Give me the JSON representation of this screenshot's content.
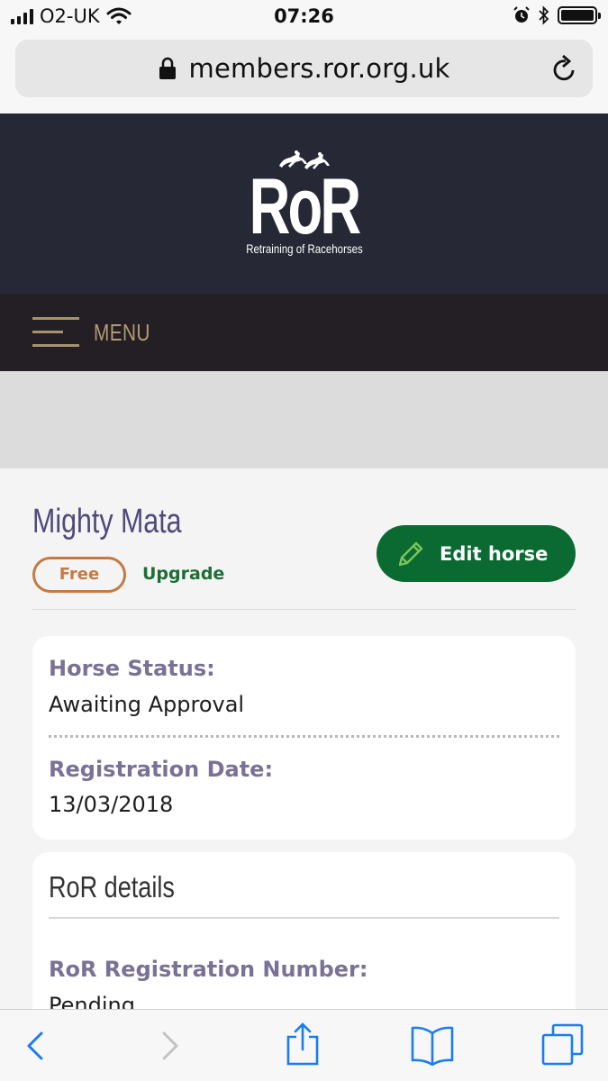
{
  "status_bar": {
    "carrier": "O2-UK",
    "time": "07:26",
    "battery_level": 1.0
  },
  "browser": {
    "url": "members.ror.org.uk"
  },
  "site": {
    "logo_text": "RoR",
    "logo_subtitle": "Retraining of Racehorses",
    "menu_label": "MENU"
  },
  "horse": {
    "name": "Mighty Mata",
    "membership_badge": "Free",
    "upgrade_link": "Upgrade",
    "edit_button": "Edit horse"
  },
  "status_card": {
    "status_label": "Horse Status:",
    "status_value": "Awaiting Approval",
    "reg_date_label": "Registration Date:",
    "reg_date_value": "13/03/2018"
  },
  "details_card": {
    "title": "RoR details",
    "reg_number_label": "RoR Registration Number:",
    "reg_number_value": "Pending"
  },
  "colors": {
    "header_bg": "#272836",
    "menu_bg": "#231f24",
    "menu_accent": "#b39b73",
    "horse_name": "#4f4a7a",
    "free_badge": "#c47a45",
    "primary_green": "#0b6a32",
    "label_purple": "#7a7296",
    "ios_blue": "#1a7cf5"
  },
  "icons": {
    "signal": "signal-bars-icon",
    "wifi": "wifi-icon",
    "alarm": "alarm-clock-icon",
    "bluetooth": "bluetooth-icon",
    "battery": "battery-icon",
    "lock": "lock-icon",
    "reload": "reload-icon",
    "menu": "hamburger-icon",
    "edit": "pencil-icon",
    "back": "chevron-left-icon",
    "forward": "chevron-right-icon",
    "share": "share-icon",
    "bookmarks": "bookmarks-icon",
    "tabs": "tabs-icon"
  }
}
